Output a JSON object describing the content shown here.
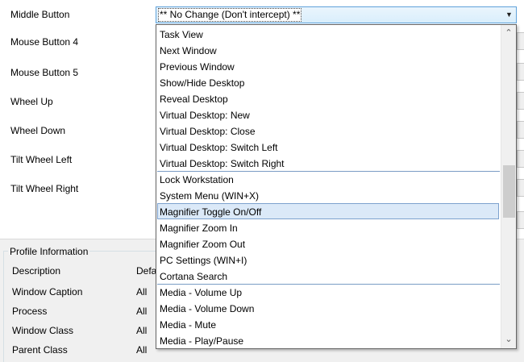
{
  "buttons": {
    "middle": "Middle Button",
    "mouse4": "Mouse Button 4",
    "mouse5": "Mouse Button 5",
    "wheel_up": "Wheel Up",
    "wheel_down": "Wheel Down",
    "tilt_left": "Tilt Wheel Left",
    "tilt_right": "Tilt Wheel Right"
  },
  "combo": {
    "selected": "** No Change (Don't intercept) **"
  },
  "dropdown": {
    "items": [
      "Task View",
      "Next Window",
      "Previous Window",
      "Show/Hide Desktop",
      "Reveal Desktop",
      "Virtual Desktop: New",
      "Virtual Desktop: Close",
      "Virtual Desktop: Switch Left",
      "Virtual Desktop: Switch Right",
      "Lock Workstation",
      "System Menu (WIN+X)",
      "Magnifier Toggle On/Off",
      "Magnifier Zoom In",
      "Magnifier Zoom Out",
      "PC Settings (WIN+I)",
      "Cortana Search",
      "Media - Volume Up",
      "Media - Volume Down",
      "Media - Mute",
      "Media - Play/Pause"
    ],
    "highlighted": "Magnifier Toggle On/Off"
  },
  "profile": {
    "title": "Profile Information",
    "rows": [
      {
        "label": "Description",
        "value": "Defa"
      },
      {
        "label": "Window Caption",
        "value": "All"
      },
      {
        "label": "Process",
        "value": "All"
      },
      {
        "label": "Window Class",
        "value": "All"
      },
      {
        "label": "Parent Class",
        "value": "All"
      }
    ]
  },
  "icons": {
    "combo_arrow": "chevron-down-icon",
    "scroll_up": "chevron-up-icon",
    "scroll_down": "chevron-down-icon"
  },
  "colors": {
    "selection_bg": "#dbe9f8",
    "selection_border": "#7da2ce",
    "combo_border": "#5fa2da"
  }
}
